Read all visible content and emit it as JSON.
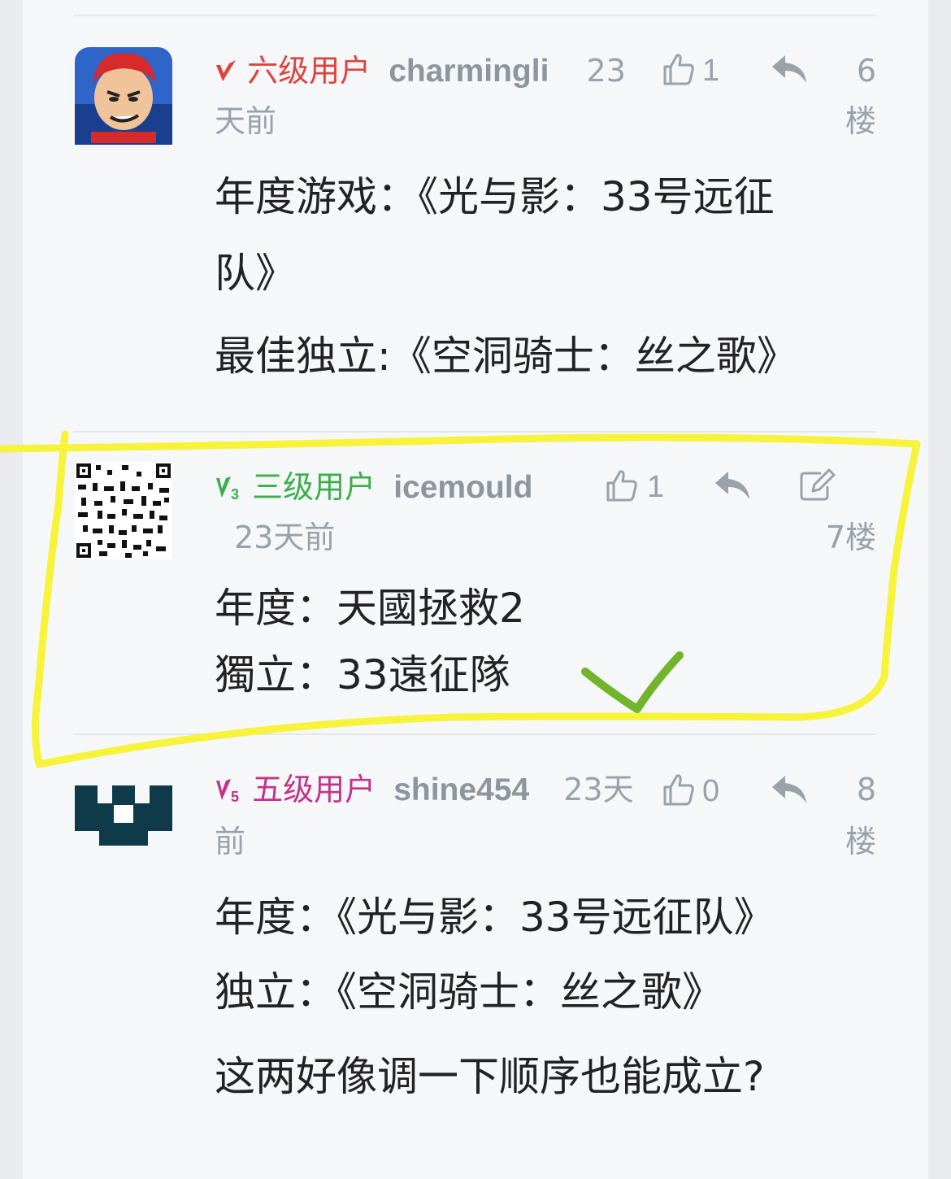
{
  "comments": [
    {
      "level": "六级用户",
      "username": "charmingli",
      "time_a": "23",
      "time_b": "天前",
      "likes": "1",
      "floor_a": "6",
      "floor_b": "楼",
      "lines": [
        "年度游戏：《光与影：33号远征",
        "队》",
        "最佳独立:《空洞骑士：丝之歌》"
      ],
      "level_color": "#e0433d",
      "avatar_icon": "slam-dunk-character-avatar"
    },
    {
      "level": "三级用户",
      "username": "icemould",
      "time": "23天前",
      "likes": "1",
      "floor": "7楼",
      "lines": [
        "年度：天國拯救2",
        "獨立：33遠征隊"
      ],
      "level_color": "#3bb04a",
      "avatar_icon": "qr-code-avatar"
    },
    {
      "level": "五级用户",
      "username": "shine454",
      "time_a": "23天",
      "time_b": "前",
      "likes": "0",
      "floor_a": "8",
      "floor_b": "楼",
      "lines": [
        "年度：《光与影：33号远征队》",
        "独立：《空洞骑士：丝之歌》",
        "这两好像调一下顺序也能成立?"
      ],
      "level_color": "#c4338a",
      "avatar_icon": "pixel-crown-avatar"
    }
  ],
  "badges": {
    "v3": "3",
    "v5": "5"
  },
  "colors": {
    "annotation": "#f7f23a",
    "checkmark": "#72b52c"
  }
}
